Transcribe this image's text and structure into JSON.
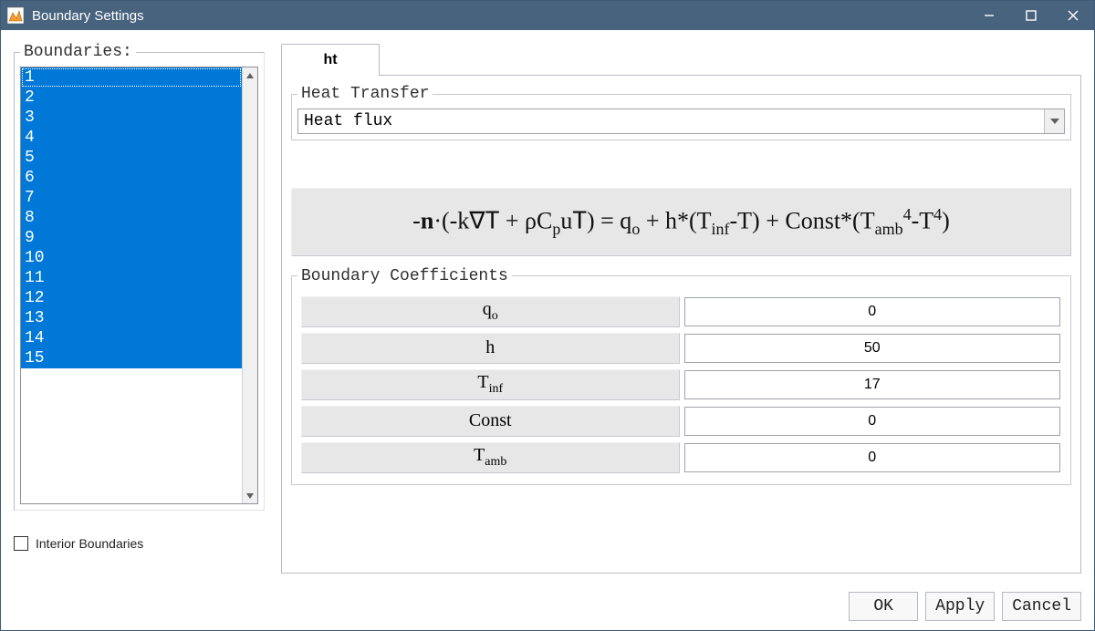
{
  "window": {
    "title": "Boundary Settings"
  },
  "sidebar": {
    "legend": "Boundaries:",
    "items": [
      "1",
      "2",
      "3",
      "4",
      "5",
      "6",
      "7",
      "8",
      "9",
      "10",
      "11",
      "12",
      "13",
      "14",
      "15"
    ],
    "interior_label": "Interior Boundaries",
    "interior_checked": false
  },
  "tabs": {
    "active": "ht"
  },
  "heat_transfer": {
    "legend": "Heat Transfer",
    "condition": "Heat flux"
  },
  "equation_plain": "-n·(-k∇T + ρC_p uT) = q_o + h*(T_inf - T) + Const*(T_amb^4 - T^4)",
  "coefficients": {
    "legend": "Boundary Coefficients",
    "rows": [
      {
        "key": "q_o",
        "label": "q",
        "sub": "o",
        "value": "0"
      },
      {
        "key": "h",
        "label": "h",
        "sub": "",
        "value": "50"
      },
      {
        "key": "T_inf",
        "label": "T",
        "sub": "inf",
        "value": "17"
      },
      {
        "key": "Const",
        "label": "Const",
        "sub": "",
        "value": "0"
      },
      {
        "key": "T_amb",
        "label": "T",
        "sub": "amb",
        "value": "0"
      }
    ]
  },
  "buttons": {
    "ok": "OK",
    "apply": "Apply",
    "cancel": "Cancel"
  }
}
